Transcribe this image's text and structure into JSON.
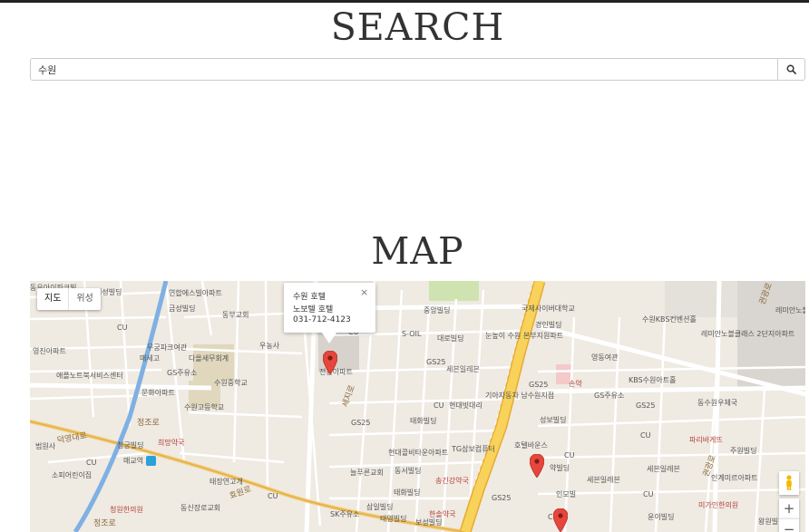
{
  "header": {
    "search_title": "SEARCH",
    "map_title": "MAP"
  },
  "search": {
    "value": "수원",
    "placeholder": "",
    "icon": "search-icon"
  },
  "map": {
    "type_controls": {
      "map": "지도",
      "satellite": "위성"
    },
    "infowindow": {
      "line1": "수원 호텔",
      "line2": "노보텔 호텔",
      "line3": "031-712-4123",
      "close": "×"
    },
    "zoom": {
      "in": "+",
      "out": "−"
    },
    "labels": {
      "l01": "동우아이파크빌",
      "l02": "거성빌딩",
      "l03": "연합에스빌아파트",
      "l04": "금성빌딩",
      "l05": "동부교회",
      "l06": "영진아파트",
      "l07": "무궁파크여관",
      "l08": "매세고",
      "l09": "다올세무회계",
      "l10": "애플노트북서비스센터",
      "l11": "GS주유소",
      "l12": "수원중학교",
      "l13": "문화아파트",
      "l14": "수원고등학교",
      "l15": "정조로",
      "l16": "범원사",
      "l17": "청궁빌딩",
      "l18": "희망약국",
      "l19": "매교역",
      "l20": "소피어린이집",
      "l21": "청원한의원",
      "l22": "동신장로교회",
      "l23": "정조로",
      "l24": "우농사",
      "l25": "전원아파트",
      "l26": "중앙빌딩",
      "l27": "S-OIL",
      "l28": "대로빌딩",
      "l29": "눈높이 수원 본부지원파트",
      "l30": "국제사이버대학교",
      "l31": "경인빌딩",
      "l32": "수원KBS컨벤션홀",
      "l33": "레미안노블클래스 2단지아파트",
      "l34": "레미안노블 1단지",
      "l35": "GS25",
      "l36": "세븐일레븐",
      "l37": "기아자동차 남수원지점",
      "l38": "영동여관",
      "l39": "GS25",
      "l40": "손약",
      "l41": "GS주유소",
      "l42": "KBS수원아트홀",
      "l43": "GS25",
      "l44": "동수원우체국",
      "l45": "세지로",
      "l46": "GS25",
      "l47": "CU",
      "l48": "현대빗대리",
      "l49": "성보빌딩",
      "l50": "태화빌딩",
      "l51": "현대콜비타운아파트",
      "l52": "TG삼보컴퓨터",
      "l53": "호텔바운스",
      "l54": "CU",
      "l55": "파리바게뜨",
      "l56": "주원빌딩",
      "l57": "늘푸른교회",
      "l58": "동서빌딩",
      "l59": "송긴강약국",
      "l60": "세븐일레븐",
      "l61": "세븐일레븐",
      "l62": "인계미르아파트",
      "l63": "태화빌딩",
      "l64": "삼일빌딩",
      "l65": "SK주유소",
      "l66": "태영빌딩",
      "l67": "보성빌딩",
      "l68": "한솔약국",
      "l69": "GS25",
      "l70": "인모빌",
      "l71": "CU",
      "l72": "윤이빌딩",
      "l73": "미가인한의원",
      "l74": "왕원빌딩",
      "l75": "권광로",
      "l76": "효원로",
      "l77": "덕영대로",
      "l78": "태장연고개",
      "l79": "CU",
      "l80": "CU",
      "l81": "CU",
      "l82": "CU",
      "l83": "CU",
      "l84": "약빌딩",
      "l85": "CU",
      "l86": "권광로"
    }
  },
  "colors": {
    "background": "#ffffff",
    "heading": "#333333",
    "map_bg": "#efeae2",
    "main_road": "#f6c64d",
    "marker": "#e8453c",
    "water": "#7fb0e3",
    "park": "#cfe3b0"
  }
}
